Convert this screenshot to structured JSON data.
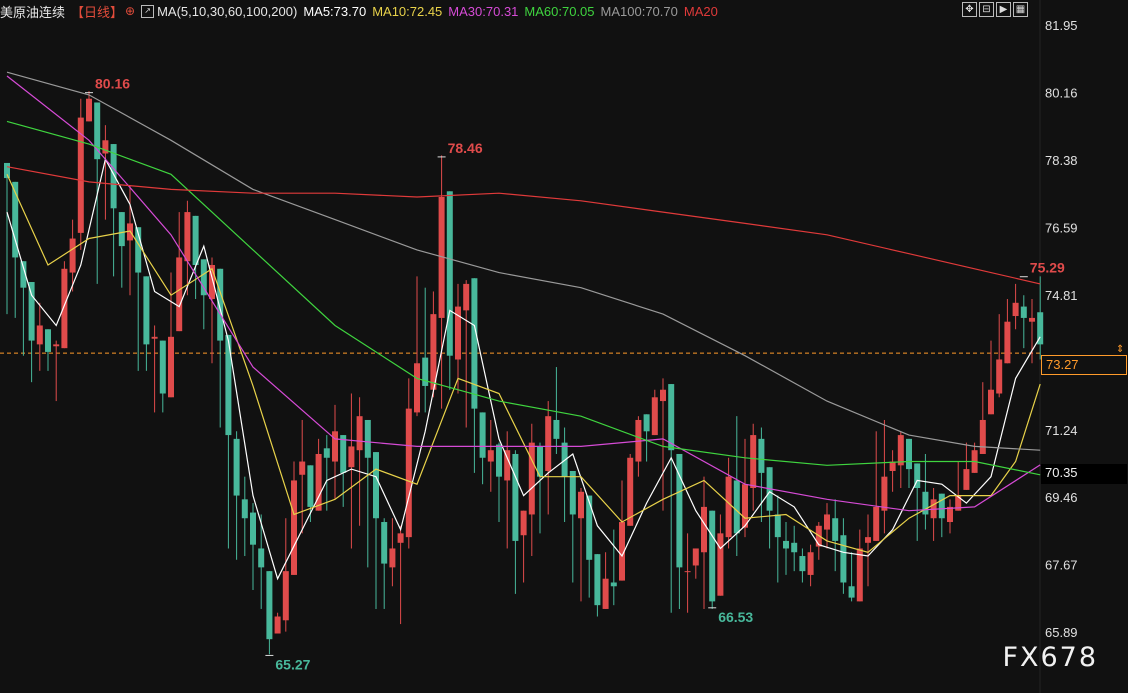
{
  "header": {
    "instrument": "美原油连续",
    "period": "【日线】",
    "period_icon": "circle-plus-icon",
    "ma_icon": "chart-icon",
    "ma_params": "MA(5,10,30,60,100,200)",
    "ma5": "MA5:73.70",
    "ma10": "MA10:72.45",
    "ma30": "MA30:70.31",
    "ma60": "MA60:70.05",
    "ma100": "MA100:70.70",
    "ma20": "MA20"
  },
  "toolbar": {
    "icons": [
      "move-icon",
      "zoom-fit-icon",
      "play-icon",
      "settings-icon"
    ],
    "glyphs": [
      "✥",
      "⊟",
      "▶",
      "▦"
    ]
  },
  "colors": {
    "background": "#111111",
    "up": "#e04b4b",
    "down": "#48b89b",
    "ma5": "#ffffff",
    "ma10": "#e8d24a",
    "ma30": "#d64bd6",
    "ma60": "#3fd43f",
    "ma100": "#9a9a9a",
    "ma20": "#e03a3a",
    "dashed": "#ff9b2b"
  },
  "watermark": "FX678",
  "chart_data": {
    "type": "candlestick",
    "y_axis_ticks": [
      "81.95",
      "80.16",
      "78.38",
      "76.59",
      "74.81",
      "73.27",
      "71.24",
      "70.35",
      "69.46",
      "67.67",
      "65.89"
    ],
    "current_price": "73.27",
    "marker_price": "70.35",
    "annotations": [
      {
        "label": "80.16",
        "index": 10,
        "value": 80.16,
        "type": "high"
      },
      {
        "label": "78.46",
        "index": 53,
        "value": 78.46,
        "type": "high"
      },
      {
        "label": "65.27",
        "index": 32,
        "value": 65.27,
        "type": "low"
      },
      {
        "label": "66.53",
        "index": 86,
        "value": 66.53,
        "type": "low"
      },
      {
        "label": "75.29",
        "index": 124,
        "value": 75.29,
        "type": "high"
      }
    ],
    "closes": [
      77.9,
      75.8,
      75.0,
      73.6,
      74.0,
      73.3,
      73.5,
      75.5,
      76.3,
      79.5,
      80.0,
      78.4,
      78.9,
      77.1,
      76.1,
      76.7,
      75.4,
      73.5,
      73.7,
      72.2,
      73.7,
      75.8,
      77.0,
      75.6,
      74.8,
      75.6,
      73.6,
      71.1,
      69.5,
      68.9,
      68.2,
      67.6,
      65.7,
      66.3,
      67.5,
      69.9,
      70.4,
      69.2,
      70.6,
      70.5,
      71.2,
      70.1,
      70.8,
      71.6,
      70.5,
      68.9,
      67.7,
      68.1,
      68.5,
      71.8,
      73.0,
      72.4,
      74.3,
      77.4,
      73.2,
      74.5,
      75.1,
      71.8,
      70.5,
      70.7,
      70.0,
      70.7,
      68.3,
      69.1,
      70.9,
      70.0,
      71.6,
      71.0,
      70.0,
      69.0,
      69.6,
      67.8,
      66.6,
      67.3,
      67.1,
      68.8,
      70.5,
      71.5,
      71.2,
      72.1,
      72.3,
      70.7,
      67.6,
      67.5,
      68.1,
      69.2,
      66.7,
      68.5,
      70.0,
      68.5,
      69.8,
      71.1,
      70.1,
      69.1,
      68.4,
      68.1,
      68.0,
      67.5,
      68.0,
      68.7,
      69.0,
      68.3,
      67.2,
      66.8,
      68.1,
      68.4,
      69.2,
      70.0,
      70.4,
      71.1,
      70.2,
      69.7,
      69.0,
      69.4,
      68.9,
      69.2,
      69.5,
      70.2,
      70.7,
      71.5,
      72.3,
      73.1,
      74.1,
      74.6,
      74.2,
      74.2,
      73.5
    ],
    "highs": [
      78.0,
      75.9,
      75.1,
      73.8,
      74.6,
      73.6,
      73.6,
      75.7,
      76.8,
      80.0,
      80.2,
      79.2,
      79.3,
      77.1,
      77.0,
      77.7,
      75.5,
      74.1,
      74.0,
      73.5,
      75.4,
      77.0,
      77.3,
      76.2,
      75.6,
      75.8,
      75.2,
      73.5,
      71.2,
      70.0,
      69.3,
      69.0,
      67.1,
      66.4,
      68.9,
      70.4,
      71.5,
      70.2,
      71.0,
      71.1,
      71.9,
      70.7,
      72.2,
      72.1,
      70.6,
      69.6,
      68.9,
      68.9,
      68.7,
      72.6,
      75.3,
      75.0,
      74.9,
      78.5,
      77.1,
      75.1,
      75.2,
      71.9,
      71.2,
      71.5,
      70.9,
      71.2,
      70.7,
      69.1,
      71.4,
      70.9,
      72.0,
      72.9,
      71.3,
      70.1,
      69.7,
      69.3,
      67.8,
      68.0,
      68.6,
      69.9,
      70.6,
      71.6,
      71.6,
      72.3,
      72.6,
      71.9,
      70.2,
      68.5,
      68.1,
      70.0,
      69.0,
      69.0,
      70.5,
      71.6,
      71.0,
      71.4,
      71.3,
      70.1,
      69.5,
      68.8,
      68.7,
      68.1,
      68.2,
      68.8,
      69.3,
      69.4,
      68.9,
      68.0,
      68.6,
      69.0,
      71.2,
      71.5,
      70.7,
      71.2,
      70.7,
      70.3,
      70.6,
      69.7,
      69.5,
      69.4,
      70.4,
      70.9,
      70.9,
      72.5,
      73.6,
      74.3,
      74.7,
      75.1,
      74.8,
      74.7,
      75.3
    ],
    "lows": [
      74.3,
      74.2,
      73.2,
      72.5,
      72.8,
      72.8,
      72.0,
      74.9,
      74.9,
      76.0,
      79.4,
      75.1,
      76.8,
      75.3,
      75.0,
      74.8,
      72.8,
      72.8,
      71.7,
      71.7,
      72.3,
      74.8,
      74.8,
      74.7,
      73.9,
      73.0,
      71.3,
      68.1,
      67.8,
      67.9,
      67.0,
      66.5,
      65.3,
      65.9,
      65.9,
      67.9,
      68.5,
      68.8,
      69.7,
      69.1,
      69.4,
      69.2,
      68.1,
      68.7,
      67.6,
      66.5,
      66.5,
      67.1,
      66.1,
      68.1,
      71.6,
      71.7,
      72.1,
      71.8,
      72.3,
      72.2,
      71.3,
      70.1,
      69.8,
      69.6,
      68.8,
      68.1,
      66.9,
      67.2,
      67.9,
      68.5,
      69.0,
      70.6,
      68.8,
      67.2,
      66.7,
      66.8,
      66.3,
      66.6,
      66.6,
      67.3,
      69.7,
      70.0,
      70.4,
      71.2,
      69.1,
      66.4,
      66.5,
      66.4,
      67.3,
      66.5,
      66.5,
      67.3,
      68.1,
      67.9,
      68.4,
      69.1,
      68.8,
      68.1,
      67.2,
      67.4,
      67.5,
      67.2,
      67.1,
      67.8,
      68.1,
      67.5,
      66.9,
      66.7,
      66.8,
      67.1,
      68.5,
      68.5,
      69.6,
      69.7,
      69.7,
      68.3,
      68.6,
      68.3,
      68.4,
      68.5,
      69.1,
      69.8,
      70.1,
      71.2,
      72.1,
      72.1,
      73.1,
      73.9,
      73.4,
      73.0,
      73.1
    ],
    "ma_series": [
      {
        "name": "MA5",
        "points": [
          [
            0,
            77.0
          ],
          [
            3,
            74.8
          ],
          [
            6,
            74.0
          ],
          [
            9,
            75.6
          ],
          [
            12,
            78.4
          ],
          [
            15,
            77.2
          ],
          [
            18,
            74.9
          ],
          [
            21,
            74.5
          ],
          [
            24,
            76.1
          ],
          [
            27,
            73.6
          ],
          [
            30,
            69.5
          ],
          [
            33,
            67.3
          ],
          [
            36,
            68.6
          ],
          [
            39,
            69.9
          ],
          [
            42,
            70.2
          ],
          [
            45,
            70.0
          ],
          [
            48,
            68.6
          ],
          [
            51,
            71.2
          ],
          [
            54,
            74.4
          ],
          [
            57,
            74.0
          ],
          [
            60,
            71.0
          ],
          [
            63,
            69.5
          ],
          [
            66,
            70.1
          ],
          [
            69,
            70.6
          ],
          [
            72,
            68.7
          ],
          [
            75,
            67.9
          ],
          [
            78,
            69.3
          ],
          [
            81,
            70.5
          ],
          [
            84,
            69.1
          ],
          [
            87,
            68.1
          ],
          [
            90,
            68.7
          ],
          [
            93,
            69.6
          ],
          [
            96,
            69.2
          ],
          [
            99,
            68.2
          ],
          [
            102,
            68.0
          ],
          [
            105,
            67.9
          ],
          [
            108,
            68.6
          ],
          [
            111,
            69.9
          ],
          [
            114,
            69.8
          ],
          [
            117,
            69.3
          ],
          [
            120,
            70.0
          ],
          [
            123,
            72.6
          ],
          [
            126,
            73.7
          ]
        ]
      },
      {
        "name": "MA10",
        "points": [
          [
            0,
            78.0
          ],
          [
            5,
            75.6
          ],
          [
            10,
            76.3
          ],
          [
            15,
            76.5
          ],
          [
            20,
            74.8
          ],
          [
            25,
            75.5
          ],
          [
            30,
            72.4
          ],
          [
            35,
            69.0
          ],
          [
            40,
            69.4
          ],
          [
            45,
            70.2
          ],
          [
            50,
            69.8
          ],
          [
            55,
            72.6
          ],
          [
            60,
            72.2
          ],
          [
            65,
            70.0
          ],
          [
            70,
            70.0
          ],
          [
            75,
            68.8
          ],
          [
            80,
            69.4
          ],
          [
            85,
            69.9
          ],
          [
            90,
            68.9
          ],
          [
            95,
            69.0
          ],
          [
            100,
            68.3
          ],
          [
            105,
            68.0
          ],
          [
            110,
            68.9
          ],
          [
            115,
            69.5
          ],
          [
            120,
            69.5
          ],
          [
            123,
            70.4
          ],
          [
            126,
            72.45
          ]
        ]
      },
      {
        "name": "MA30",
        "points": [
          [
            0,
            80.6
          ],
          [
            10,
            78.9
          ],
          [
            20,
            76.4
          ],
          [
            30,
            72.9
          ],
          [
            40,
            71.0
          ],
          [
            50,
            70.8
          ],
          [
            60,
            70.8
          ],
          [
            70,
            70.8
          ],
          [
            80,
            71.0
          ],
          [
            90,
            69.8
          ],
          [
            100,
            69.4
          ],
          [
            110,
            69.1
          ],
          [
            118,
            69.2
          ],
          [
            126,
            70.31
          ]
        ]
      },
      {
        "name": "MA60",
        "points": [
          [
            0,
            79.4
          ],
          [
            10,
            78.8
          ],
          [
            20,
            78.0
          ],
          [
            30,
            76.0
          ],
          [
            40,
            74.0
          ],
          [
            50,
            72.6
          ],
          [
            60,
            72.0
          ],
          [
            70,
            71.6
          ],
          [
            80,
            70.8
          ],
          [
            90,
            70.5
          ],
          [
            100,
            70.3
          ],
          [
            110,
            70.4
          ],
          [
            118,
            70.4
          ],
          [
            126,
            70.05
          ]
        ]
      },
      {
        "name": "MA100",
        "points": [
          [
            0,
            80.7
          ],
          [
            10,
            80.1
          ],
          [
            20,
            78.9
          ],
          [
            30,
            77.6
          ],
          [
            40,
            76.8
          ],
          [
            50,
            76.0
          ],
          [
            60,
            75.4
          ],
          [
            70,
            75.0
          ],
          [
            80,
            74.3
          ],
          [
            90,
            73.2
          ],
          [
            100,
            72.0
          ],
          [
            110,
            71.1
          ],
          [
            118,
            70.8
          ],
          [
            126,
            70.7
          ]
        ]
      },
      {
        "name": "MA20",
        "points": [
          [
            0,
            78.2
          ],
          [
            10,
            77.8
          ],
          [
            20,
            77.6
          ],
          [
            30,
            77.5
          ],
          [
            40,
            77.5
          ],
          [
            50,
            77.4
          ],
          [
            60,
            77.5
          ],
          [
            70,
            77.3
          ],
          [
            80,
            77.0
          ],
          [
            90,
            76.7
          ],
          [
            100,
            76.4
          ],
          [
            110,
            75.9
          ],
          [
            118,
            75.5
          ],
          [
            126,
            75.1
          ]
        ]
      }
    ]
  }
}
